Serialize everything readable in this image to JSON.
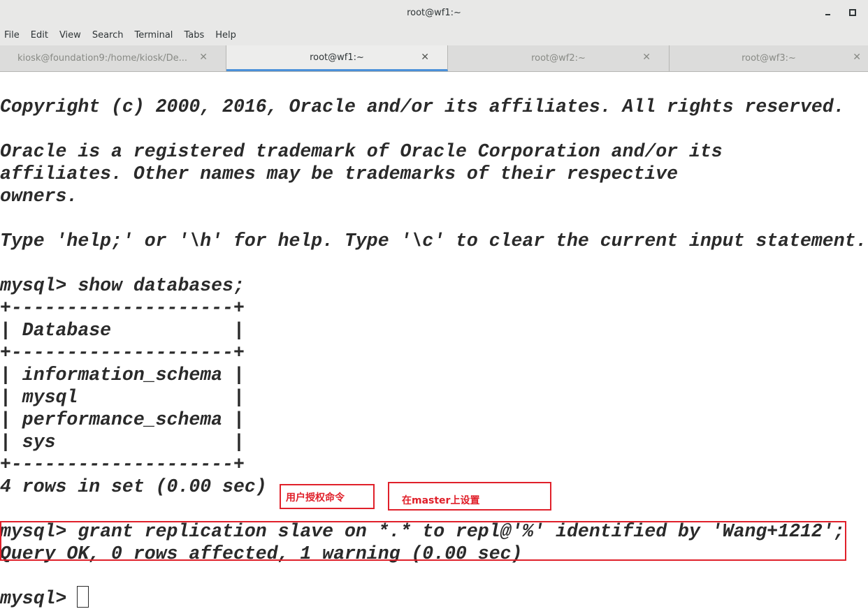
{
  "window": {
    "title": "root@wf1:~",
    "minimize_glyph": "minimize-icon",
    "maximize_glyph": "maximize-icon"
  },
  "menu": {
    "items": [
      "File",
      "Edit",
      "View",
      "Search",
      "Terminal",
      "Tabs",
      "Help"
    ]
  },
  "tabs": [
    {
      "label": "kiosk@foundation9:/home/kiosk/De...",
      "close": "✕",
      "active": false
    },
    {
      "label": "root@wf1:~",
      "close": "✕",
      "active": true
    },
    {
      "label": "root@wf2:~",
      "close": "✕",
      "active": false
    },
    {
      "label": "root@wf3:~",
      "close": "✕",
      "active": false
    }
  ],
  "terminal": {
    "lines": [
      "Copyright (c) 2000, 2016, Oracle and/or its affiliates. All rights reserved.",
      "",
      "Oracle is a registered trademark of Oracle Corporation and/or its",
      "affiliates. Other names may be trademarks of their respective",
      "owners.",
      "",
      "Type 'help;' or '\\h' for help. Type '\\c' to clear the current input statement.",
      "",
      "mysql> show databases;",
      "+--------------------+",
      "| Database           |",
      "+--------------------+",
      "| information_schema |",
      "| mysql              |",
      "| performance_schema |",
      "| sys                |",
      "+--------------------+",
      "4 rows in set (0.00 sec)",
      "",
      "mysql> grant replication slave on *.* to repl@'%' identified by 'Wang+1212';",
      "Query OK, 0 rows affected, 1 warning (0.00 sec)",
      "",
      "mysql> "
    ]
  },
  "annotations": {
    "label_1": "用户授权命令",
    "label_2": "在master上设置",
    "color": "#e0202a"
  },
  "colors": {
    "chrome": "#e8e8e7",
    "active_tab_underline": "#4a90d9",
    "terminal_bg": "#ffffff",
    "terminal_fg": "#2a2a2a"
  }
}
